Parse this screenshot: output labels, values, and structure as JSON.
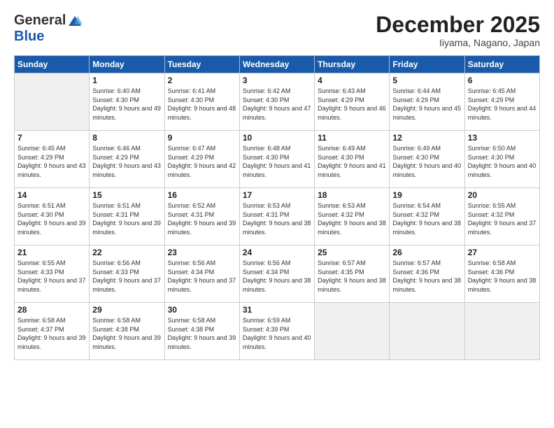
{
  "logo": {
    "general": "General",
    "blue": "Blue"
  },
  "title": "December 2025",
  "subtitle": "Iiyama, Nagano, Japan",
  "headers": [
    "Sunday",
    "Monday",
    "Tuesday",
    "Wednesday",
    "Thursday",
    "Friday",
    "Saturday"
  ],
  "weeks": [
    [
      {
        "day": "",
        "sunrise": "",
        "sunset": "",
        "daylight": "",
        "empty": true
      },
      {
        "day": "1",
        "sunrise": "Sunrise: 6:40 AM",
        "sunset": "Sunset: 4:30 PM",
        "daylight": "Daylight: 9 hours and 49 minutes.",
        "empty": false
      },
      {
        "day": "2",
        "sunrise": "Sunrise: 6:41 AM",
        "sunset": "Sunset: 4:30 PM",
        "daylight": "Daylight: 9 hours and 48 minutes.",
        "empty": false
      },
      {
        "day": "3",
        "sunrise": "Sunrise: 6:42 AM",
        "sunset": "Sunset: 4:30 PM",
        "daylight": "Daylight: 9 hours and 47 minutes.",
        "empty": false
      },
      {
        "day": "4",
        "sunrise": "Sunrise: 6:43 AM",
        "sunset": "Sunset: 4:29 PM",
        "daylight": "Daylight: 9 hours and 46 minutes.",
        "empty": false
      },
      {
        "day": "5",
        "sunrise": "Sunrise: 6:44 AM",
        "sunset": "Sunset: 4:29 PM",
        "daylight": "Daylight: 9 hours and 45 minutes.",
        "empty": false
      },
      {
        "day": "6",
        "sunrise": "Sunrise: 6:45 AM",
        "sunset": "Sunset: 4:29 PM",
        "daylight": "Daylight: 9 hours and 44 minutes.",
        "empty": false
      }
    ],
    [
      {
        "day": "7",
        "sunrise": "Sunrise: 6:45 AM",
        "sunset": "Sunset: 4:29 PM",
        "daylight": "Daylight: 9 hours and 43 minutes.",
        "empty": false
      },
      {
        "day": "8",
        "sunrise": "Sunrise: 6:46 AM",
        "sunset": "Sunset: 4:29 PM",
        "daylight": "Daylight: 9 hours and 43 minutes.",
        "empty": false
      },
      {
        "day": "9",
        "sunrise": "Sunrise: 6:47 AM",
        "sunset": "Sunset: 4:29 PM",
        "daylight": "Daylight: 9 hours and 42 minutes.",
        "empty": false
      },
      {
        "day": "10",
        "sunrise": "Sunrise: 6:48 AM",
        "sunset": "Sunset: 4:30 PM",
        "daylight": "Daylight: 9 hours and 41 minutes.",
        "empty": false
      },
      {
        "day": "11",
        "sunrise": "Sunrise: 6:49 AM",
        "sunset": "Sunset: 4:30 PM",
        "daylight": "Daylight: 9 hours and 41 minutes.",
        "empty": false
      },
      {
        "day": "12",
        "sunrise": "Sunrise: 6:49 AM",
        "sunset": "Sunset: 4:30 PM",
        "daylight": "Daylight: 9 hours and 40 minutes.",
        "empty": false
      },
      {
        "day": "13",
        "sunrise": "Sunrise: 6:50 AM",
        "sunset": "Sunset: 4:30 PM",
        "daylight": "Daylight: 9 hours and 40 minutes.",
        "empty": false
      }
    ],
    [
      {
        "day": "14",
        "sunrise": "Sunrise: 6:51 AM",
        "sunset": "Sunset: 4:30 PM",
        "daylight": "Daylight: 9 hours and 39 minutes.",
        "empty": false
      },
      {
        "day": "15",
        "sunrise": "Sunrise: 6:51 AM",
        "sunset": "Sunset: 4:31 PM",
        "daylight": "Daylight: 9 hours and 39 minutes.",
        "empty": false
      },
      {
        "day": "16",
        "sunrise": "Sunrise: 6:52 AM",
        "sunset": "Sunset: 4:31 PM",
        "daylight": "Daylight: 9 hours and 39 minutes.",
        "empty": false
      },
      {
        "day": "17",
        "sunrise": "Sunrise: 6:53 AM",
        "sunset": "Sunset: 4:31 PM",
        "daylight": "Daylight: 9 hours and 38 minutes.",
        "empty": false
      },
      {
        "day": "18",
        "sunrise": "Sunrise: 6:53 AM",
        "sunset": "Sunset: 4:32 PM",
        "daylight": "Daylight: 9 hours and 38 minutes.",
        "empty": false
      },
      {
        "day": "19",
        "sunrise": "Sunrise: 6:54 AM",
        "sunset": "Sunset: 4:32 PM",
        "daylight": "Daylight: 9 hours and 38 minutes.",
        "empty": false
      },
      {
        "day": "20",
        "sunrise": "Sunrise: 6:55 AM",
        "sunset": "Sunset: 4:32 PM",
        "daylight": "Daylight: 9 hours and 37 minutes.",
        "empty": false
      }
    ],
    [
      {
        "day": "21",
        "sunrise": "Sunrise: 6:55 AM",
        "sunset": "Sunset: 4:33 PM",
        "daylight": "Daylight: 9 hours and 37 minutes.",
        "empty": false
      },
      {
        "day": "22",
        "sunrise": "Sunrise: 6:56 AM",
        "sunset": "Sunset: 4:33 PM",
        "daylight": "Daylight: 9 hours and 37 minutes.",
        "empty": false
      },
      {
        "day": "23",
        "sunrise": "Sunrise: 6:56 AM",
        "sunset": "Sunset: 4:34 PM",
        "daylight": "Daylight: 9 hours and 37 minutes.",
        "empty": false
      },
      {
        "day": "24",
        "sunrise": "Sunrise: 6:56 AM",
        "sunset": "Sunset: 4:34 PM",
        "daylight": "Daylight: 9 hours and 38 minutes.",
        "empty": false
      },
      {
        "day": "25",
        "sunrise": "Sunrise: 6:57 AM",
        "sunset": "Sunset: 4:35 PM",
        "daylight": "Daylight: 9 hours and 38 minutes.",
        "empty": false
      },
      {
        "day": "26",
        "sunrise": "Sunrise: 6:57 AM",
        "sunset": "Sunset: 4:36 PM",
        "daylight": "Daylight: 9 hours and 38 minutes.",
        "empty": false
      },
      {
        "day": "27",
        "sunrise": "Sunrise: 6:58 AM",
        "sunset": "Sunset: 4:36 PM",
        "daylight": "Daylight: 9 hours and 38 minutes.",
        "empty": false
      }
    ],
    [
      {
        "day": "28",
        "sunrise": "Sunrise: 6:58 AM",
        "sunset": "Sunset: 4:37 PM",
        "daylight": "Daylight: 9 hours and 39 minutes.",
        "empty": false
      },
      {
        "day": "29",
        "sunrise": "Sunrise: 6:58 AM",
        "sunset": "Sunset: 4:38 PM",
        "daylight": "Daylight: 9 hours and 39 minutes.",
        "empty": false
      },
      {
        "day": "30",
        "sunrise": "Sunrise: 6:58 AM",
        "sunset": "Sunset: 4:38 PM",
        "daylight": "Daylight: 9 hours and 39 minutes.",
        "empty": false
      },
      {
        "day": "31",
        "sunrise": "Sunrise: 6:59 AM",
        "sunset": "Sunset: 4:39 PM",
        "daylight": "Daylight: 9 hours and 40 minutes.",
        "empty": false
      },
      {
        "day": "",
        "sunrise": "",
        "sunset": "",
        "daylight": "",
        "empty": true
      },
      {
        "day": "",
        "sunrise": "",
        "sunset": "",
        "daylight": "",
        "empty": true
      },
      {
        "day": "",
        "sunrise": "",
        "sunset": "",
        "daylight": "",
        "empty": true
      }
    ]
  ]
}
